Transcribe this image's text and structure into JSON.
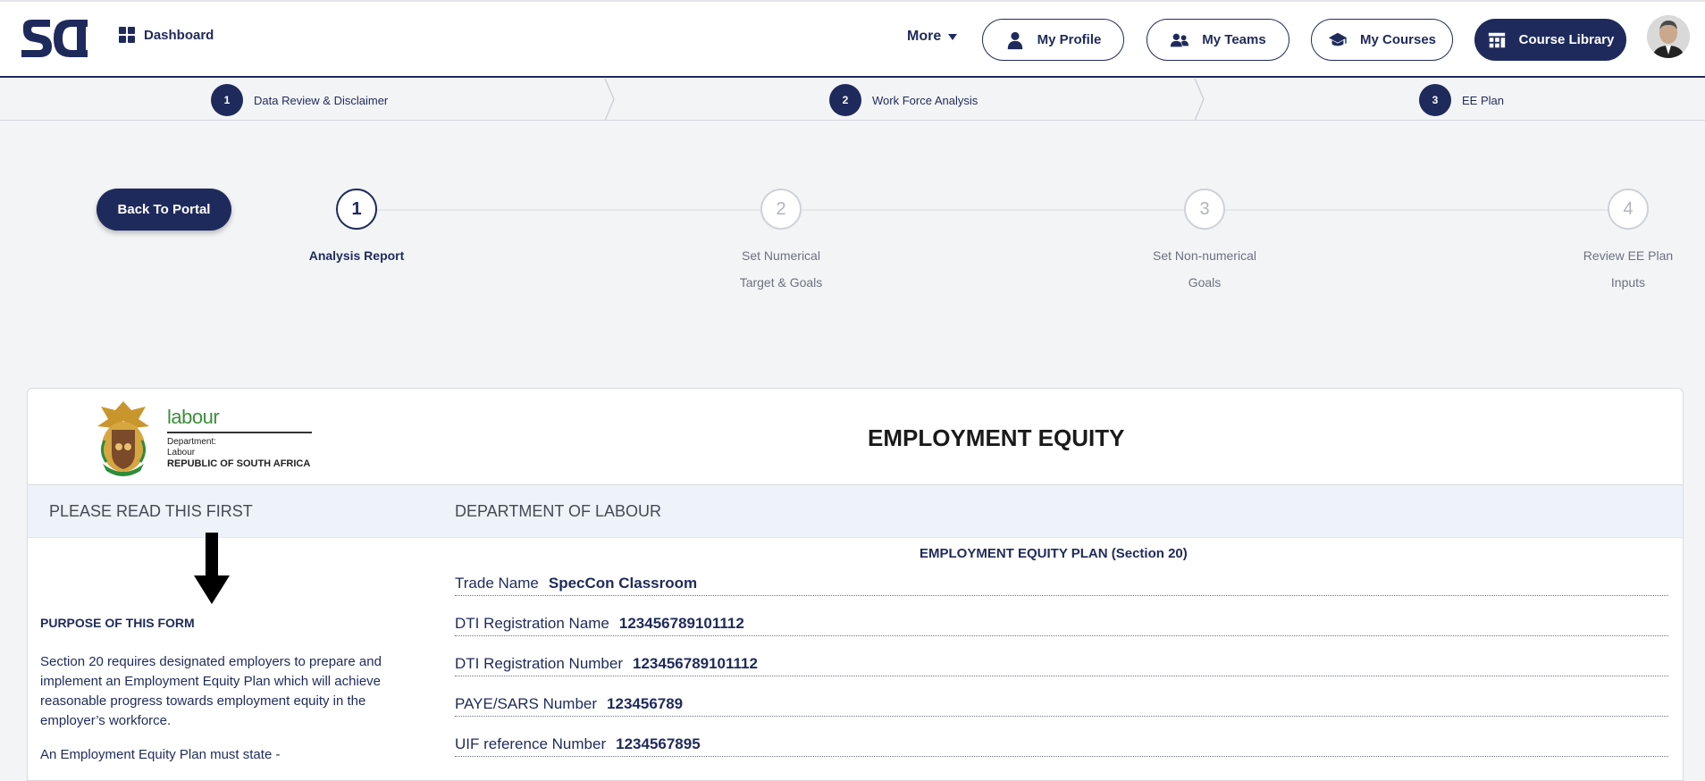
{
  "nav": {
    "dashboard": "Dashboard",
    "more": "More",
    "my_profile": "My Profile",
    "my_teams": "My Teams",
    "my_courses": "My Courses",
    "course_library": "Course Library"
  },
  "stages": [
    {
      "num": "1",
      "label": "Data Review & Disclaimer"
    },
    {
      "num": "2",
      "label": "Work Force Analysis"
    },
    {
      "num": "3",
      "label": "EE Plan"
    }
  ],
  "back_button": "Back To Portal",
  "steps": [
    {
      "num": "1",
      "line1": "Analysis Report",
      "line2": ""
    },
    {
      "num": "2",
      "line1": "Set Numerical",
      "line2": "Target & Goals"
    },
    {
      "num": "3",
      "line1": "Set Non-numerical",
      "line2": "Goals"
    },
    {
      "num": "4",
      "line1": "Review EE Plan",
      "line2": "Inputs"
    }
  ],
  "form": {
    "logo_word": "labour",
    "logo_dept": "Department:",
    "logo_dept2": "Labour",
    "logo_country": "REPUBLIC OF SOUTH AFRICA",
    "title": "EMPLOYMENT EQUITY",
    "left_header": "PLEASE READ THIS FIRST",
    "right_header": "DEPARTMENT OF LABOUR",
    "purpose_title": "PURPOSE OF THIS FORM",
    "purpose_p1": "Section 20 requires designated employers to prepare and implement an Employment Equity Plan which will achieve reasonable progress towards employment equity in the employer’s workforce.",
    "purpose_p2": "An Employment Equity Plan must state -",
    "plan_title": "EMPLOYMENT EQUITY PLAN (Section 20)",
    "fields": [
      {
        "label": "Trade Name",
        "value": "SpecCon Classroom"
      },
      {
        "label": "DTI Registration Name",
        "value": "123456789101112"
      },
      {
        "label": "DTI Registration Number",
        "value": "123456789101112"
      },
      {
        "label": "PAYE/SARS Number",
        "value": "123456789"
      },
      {
        "label": "UIF reference Number",
        "value": "1234567895"
      }
    ]
  },
  "colors": {
    "primary": "#1f2a5c",
    "bg": "#f3f4f6",
    "labour_green": "#3b8f3b"
  }
}
